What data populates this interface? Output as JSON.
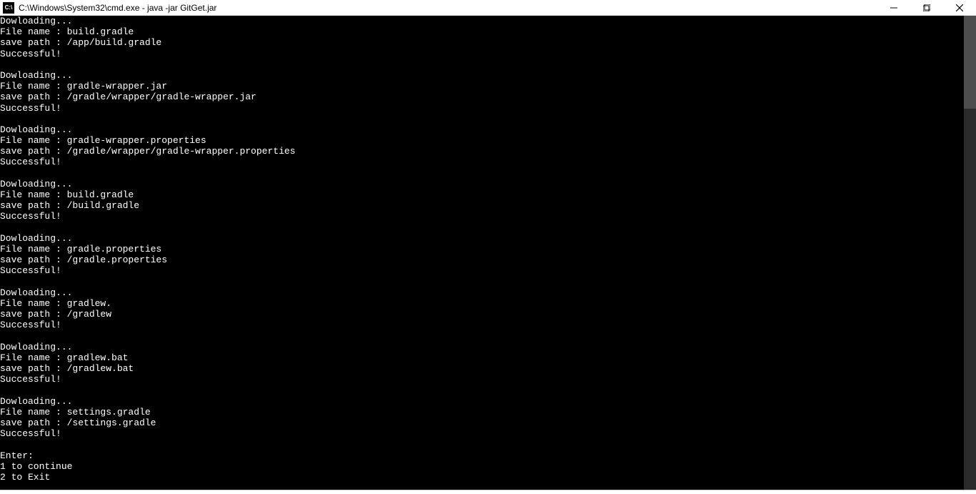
{
  "window": {
    "title": "C:\\Windows\\System32\\cmd.exe - java  -jar GitGet.jar",
    "icon_label": "C:\\"
  },
  "terminal": {
    "lines": [
      "Dowloading...",
      "File name : build.gradle",
      "save path : /app/build.gradle",
      "Successful!",
      "",
      "Dowloading...",
      "File name : gradle-wrapper.jar",
      "save path : /gradle/wrapper/gradle-wrapper.jar",
      "Successful!",
      "",
      "Dowloading...",
      "File name : gradle-wrapper.properties",
      "save path : /gradle/wrapper/gradle-wrapper.properties",
      "Successful!",
      "",
      "Dowloading...",
      "File name : build.gradle",
      "save path : /build.gradle",
      "Successful!",
      "",
      "Dowloading...",
      "File name : gradle.properties",
      "save path : /gradle.properties",
      "Successful!",
      "",
      "Dowloading...",
      "File name : gradlew.",
      "save path : /gradlew",
      "Successful!",
      "",
      "Dowloading...",
      "File name : gradlew.bat",
      "save path : /gradlew.bat",
      "Successful!",
      "",
      "Dowloading...",
      "File name : settings.gradle",
      "save path : /settings.gradle",
      "Successful!",
      "",
      "Enter:",
      "1 to continue",
      "2 to Exit"
    ]
  }
}
